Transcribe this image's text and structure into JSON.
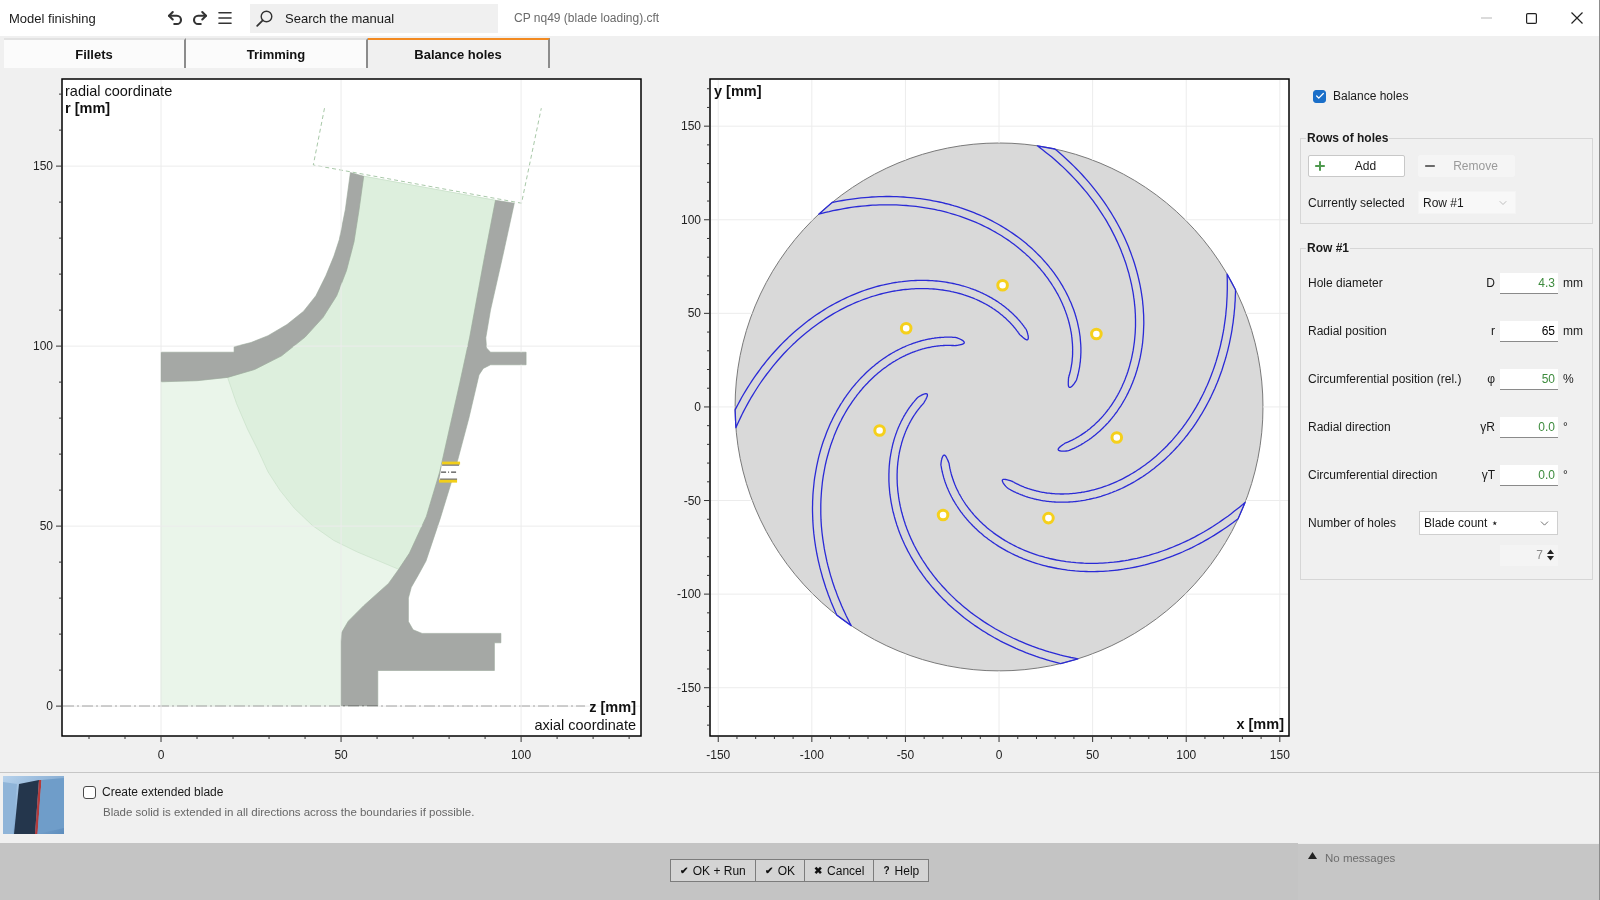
{
  "window": {
    "title": "Model finishing",
    "document": "CP nq49 (blade loading).cft",
    "controls": [
      {
        "kind": "minimize",
        "disabled": true
      },
      {
        "kind": "maximize",
        "disabled": false
      },
      {
        "kind": "close",
        "disabled": false
      }
    ]
  },
  "toolbar": {
    "search": {
      "placeholder": "Search the manual"
    }
  },
  "tabs": [
    {
      "label": "Fillets",
      "selected": false
    },
    {
      "label": "Trimming",
      "selected": false
    },
    {
      "label": "Balance holes",
      "selected": true
    }
  ],
  "meridional_view": {
    "y_caption": "radial coordinate",
    "x_caption": "axial coordinate",
    "chart_data": {
      "type": "scatter",
      "xlabel": "z [mm]",
      "ylabel": "r [mm]",
      "xlim": [
        -27.5,
        133.3
      ],
      "ylim": [
        -8.3,
        174.2
      ],
      "xticks": [
        0,
        50,
        100
      ],
      "yticks": [
        0,
        50,
        100,
        150
      ],
      "grid": true,
      "x": [
        80
      ],
      "series": [
        {
          "values": [
            65
          ]
        }
      ]
    }
  },
  "plan_view": {
    "chart_data": {
      "type": "scatter",
      "xlabel": "x [mm]",
      "ylabel": "y [mm]",
      "xlim": [
        -154.4,
        154.9
      ],
      "ylim": [
        -175.8,
        175.2
      ],
      "xticks": [
        -150,
        -100,
        -50,
        0,
        50,
        100,
        150
      ],
      "yticks": [
        -150,
        -100,
        -50,
        0,
        50,
        100,
        150
      ],
      "grid": true,
      "x": [
        1.9,
        -49.6,
        -63.8,
        -29.9,
        26.4,
        62.9,
        52.0
      ],
      "series": [
        {
          "values": [
            65.0,
            42.0,
            -12.6,
            -57.7,
            -59.4,
            -16.3,
            39.0
          ]
        }
      ]
    }
  },
  "settings": {
    "enable": {
      "label": "Balance holes",
      "checked": true
    },
    "rows_group": {
      "title": "Rows of holes",
      "buttons": [
        {
          "kind": "add",
          "label": "Add",
          "disabled": false
        },
        {
          "kind": "remove",
          "label": "Remove",
          "disabled": true
        }
      ],
      "selector": {
        "label": "Currently selected",
        "value": "Row #1"
      }
    },
    "row_group": {
      "title": "Row #1",
      "fields": [
        {
          "kind": "number",
          "label": "Hole diameter",
          "symbol": "D",
          "value": "4.3",
          "unit": "mm",
          "color": "#3d8b3d"
        },
        {
          "kind": "number",
          "label": "Radial position",
          "symbol": "r",
          "value": "65",
          "unit": "mm",
          "color": "#000000"
        },
        {
          "kind": "number",
          "label": "Circumferential position (rel.)",
          "symbol": "φ",
          "value": "50",
          "unit": "%",
          "color": "#3d8b3d"
        },
        {
          "kind": "number",
          "label": "Radial direction",
          "symbol": "γR",
          "value": "0.0",
          "unit": "°",
          "color": "#3d8b3d"
        },
        {
          "kind": "number",
          "label": "Circumferential direction",
          "symbol": "γT",
          "value": "0.0",
          "unit": "°",
          "color": "#3d8b3d"
        },
        {
          "kind": "select",
          "label": "Number of holes",
          "value": "Blade count ⋆"
        },
        {
          "kind": "spinner",
          "value": "7",
          "disabled": true
        }
      ]
    }
  },
  "extended_blade": {
    "label": "Create extended blade",
    "checked": false,
    "description": "Blade solid is extended in all directions across the boundaries if possible."
  },
  "footer": {
    "buttons": [
      {
        "symbol": "✔",
        "label": "OK + Run"
      },
      {
        "symbol": "✔",
        "label": "OK"
      },
      {
        "symbol": "✖",
        "label": "Cancel"
      },
      {
        "symbol": "?",
        "label": "Help"
      }
    ],
    "messages": {
      "text": "No messages",
      "expanded": false
    }
  }
}
